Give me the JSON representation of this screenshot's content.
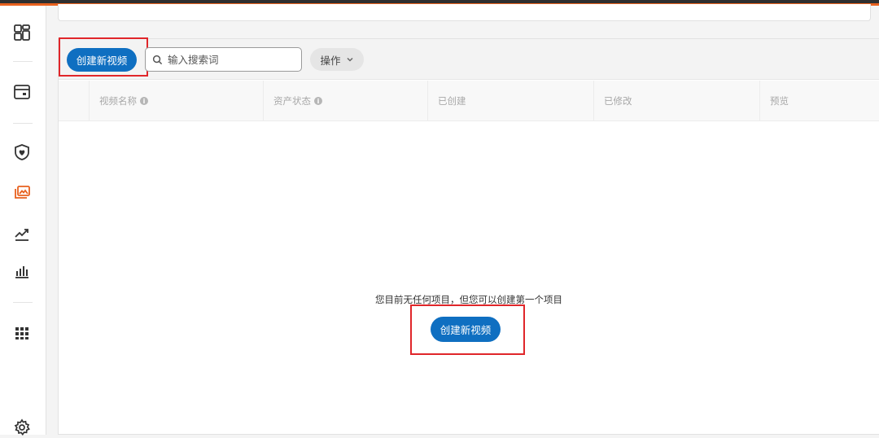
{
  "toolbar": {
    "create_label": "创建新视频",
    "search_placeholder": "输入搜索词",
    "actions_label": "操作"
  },
  "table": {
    "columns": [
      {
        "label": "视频名称",
        "info": true
      },
      {
        "label": "资产状态",
        "info": true
      },
      {
        "label": "已创建",
        "info": false
      },
      {
        "label": "已修改",
        "info": false
      },
      {
        "label": "预览",
        "info": false
      }
    ]
  },
  "empty_state": {
    "message": "您目前无任何项目，但您可以创建第一个项目",
    "button_label": "创建新视频"
  },
  "sidebar": {
    "icons": [
      "dashboard-icon",
      "window-icon",
      "shield-icon",
      "media-library-icon",
      "trend-icon",
      "bar-chart-icon",
      "apps-grid-icon",
      "settings-icon"
    ],
    "active": "media-library-icon"
  },
  "colors": {
    "primary": "#0f6fc1",
    "accent": "#e8611e",
    "highlight": "#e0262a"
  }
}
